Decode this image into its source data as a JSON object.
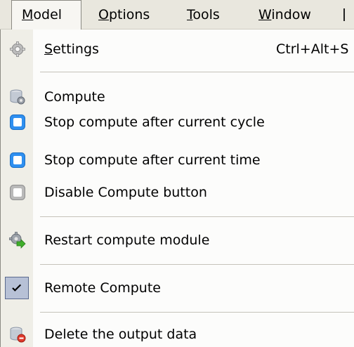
{
  "menubar": {
    "items": [
      {
        "label": "Model",
        "active": true
      },
      {
        "label": "Options"
      },
      {
        "label": "Tools"
      },
      {
        "label": "Window"
      }
    ]
  },
  "dropdown": {
    "settings": {
      "label": "Settings",
      "shortcut": "Ctrl+Alt+S",
      "icon": "gear-icon"
    },
    "compute": {
      "label": "Compute",
      "icon": "database-gear-icon"
    },
    "stop_cycle": {
      "label": "Stop compute after current cycle",
      "icon": "blue-stop-icon"
    },
    "stop_time": {
      "label": "Stop compute after current time",
      "icon": "blue-stop-icon"
    },
    "disable_compute": {
      "label": "Disable Compute button",
      "icon": "gray-stop-icon"
    },
    "restart": {
      "label": "Restart compute module",
      "icon": "gear-green-arrow-icon"
    },
    "remote": {
      "label": "Remote Compute",
      "checked": true,
      "icon": "checkmark-icon"
    },
    "delete_output": {
      "label": "Delete the output data",
      "icon": "database-delete-icon"
    }
  },
  "colors": {
    "menubar_bg": "#e9e7de",
    "gutter_bg": "#efeee7",
    "accent_blue": "#2e8ff0",
    "check_bg": "#b7c1d6"
  }
}
